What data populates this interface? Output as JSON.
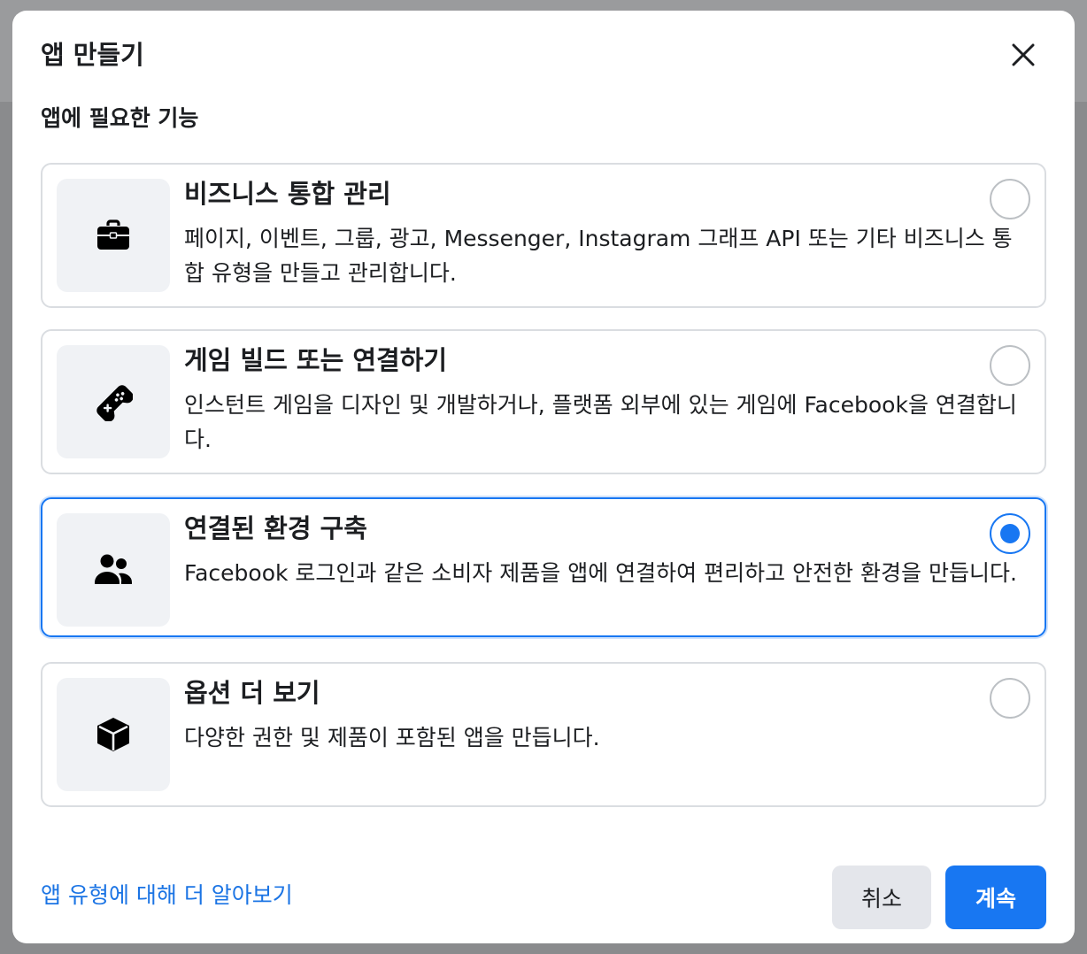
{
  "dialog": {
    "title": "앱 만들기",
    "section_label": "앱에 필요한 기능"
  },
  "options": [
    {
      "title": "비즈니스 통합 관리",
      "description": "페이지, 이벤트, 그룹, 광고, Messenger, Instagram 그래프 API 또는 기타 비즈니스 통합 유형을 만들고 관리합니다.",
      "icon": "briefcase-icon",
      "selected": false
    },
    {
      "title": "게임 빌드 또는 연결하기",
      "description": "인스턴트 게임을 디자인 및 개발하거나, 플랫폼 외부에 있는 게임에 Facebook을 연결합니다.",
      "icon": "gamepad-icon",
      "selected": false
    },
    {
      "title": "연결된 환경 구축",
      "description": "Facebook 로그인과 같은 소비자 제품을 앱에 연결하여 편리하고 안전한 환경을 만듭니다.",
      "icon": "people-icon",
      "selected": true
    },
    {
      "title": "옵션 더 보기",
      "description": "다양한 권한 및 제품이 포함된 앱을 만듭니다.",
      "icon": "cube-icon",
      "selected": false
    }
  ],
  "footer": {
    "learn_more": "앱 유형에 대해 더 알아보기",
    "cancel_label": "취소",
    "continue_label": "계속"
  },
  "colors": {
    "accent": "#1877f2",
    "link": "#1b74e4",
    "border": "#dadde1",
    "icon_bg": "#f0f2f5"
  }
}
